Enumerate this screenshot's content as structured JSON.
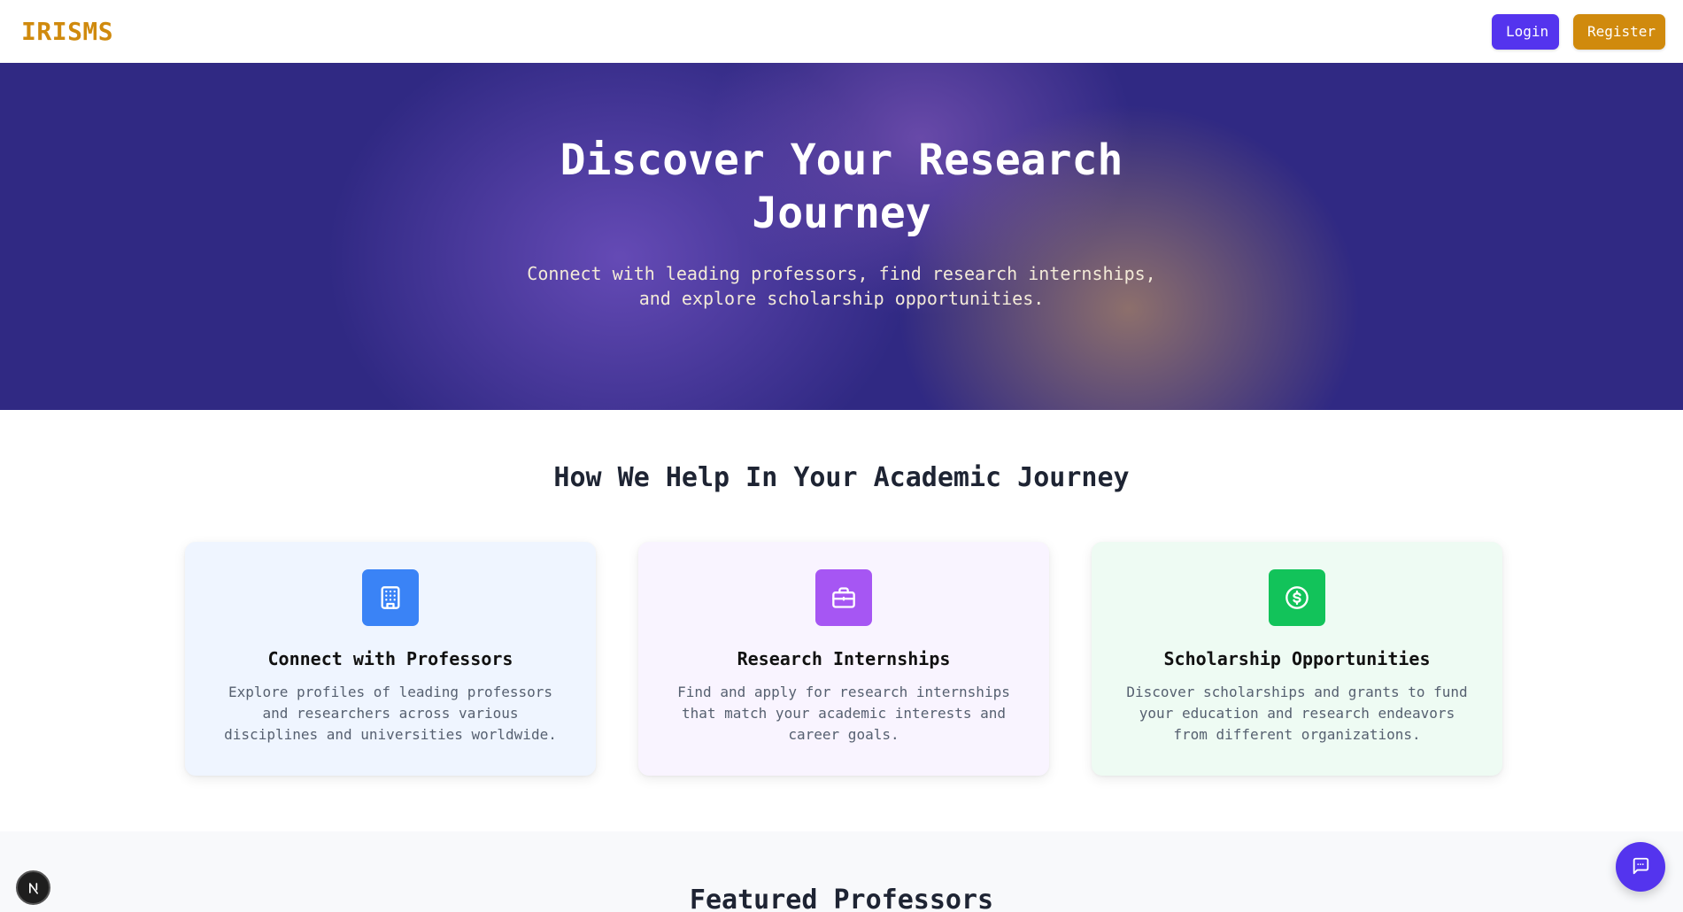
{
  "header": {
    "logo": "IRISMS",
    "login_label": "Login",
    "register_label": "Register"
  },
  "hero": {
    "title": "Discover Your Research Journey",
    "subtitle": "Connect with leading professors, find research internships, and explore scholarship opportunities."
  },
  "features": {
    "title": "How We Help In Your Academic Journey",
    "cards": [
      {
        "icon": "building-icon",
        "title": "Connect with Professors",
        "description": "Explore profiles of leading professors and researchers across various disciplines and universities worldwide."
      },
      {
        "icon": "briefcase-icon",
        "title": "Research Internships",
        "description": "Find and apply for research internships that match your academic interests and career goals."
      },
      {
        "icon": "dollar-icon",
        "title": "Scholarship Opportunities",
        "description": "Discover scholarships and grants to fund your education and research endeavors from different organizations."
      }
    ]
  },
  "featured": {
    "title": "Featured Professors"
  },
  "floating": {
    "dev_badge_icon": "nextjs-icon",
    "chat_icon": "chat-icon"
  },
  "colors": {
    "brand": "#d08a0d",
    "primary": "#5434ee",
    "hero_bg": "#302983"
  }
}
